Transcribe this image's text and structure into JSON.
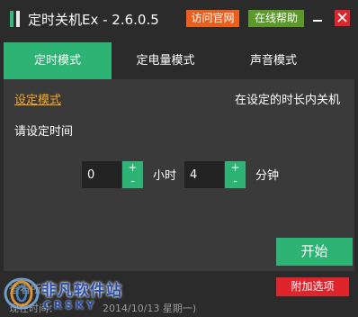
{
  "app": {
    "title": "定时关机Ex - 2.6.0.5"
  },
  "header": {
    "website_label": "访问官网",
    "help_label": "在线帮助"
  },
  "tabs": [
    {
      "label": "定时模式",
      "active": true
    },
    {
      "label": "定电量模式",
      "active": false
    },
    {
      "label": "声音模式",
      "active": false
    }
  ],
  "panel": {
    "mode_link": "设定模式",
    "mode_description": "在设定的时长内关机",
    "prompt": "请设定时间",
    "hours": {
      "value": "0",
      "unit": "小时",
      "plus": "+",
      "minus": "-"
    },
    "minutes": {
      "value": "4",
      "unit": "分钟",
      "plus": "+",
      "minus": "-"
    },
    "start_label": "开始"
  },
  "footer": {
    "reset_label": "查看所有",
    "addon_label": "附加选项",
    "status_label": "现在时间：",
    "status_date": "2014/10/13 星期一)"
  },
  "watermark": {
    "text": "非凡软件站",
    "sub": "CRSKY"
  },
  "colors": {
    "accent_green": "#2db373",
    "website_orange": "#e8601c",
    "help_green": "#5b9a2a",
    "danger_red": "#e0242c",
    "mode_link_orange": "#f5a623",
    "background": "#2b2b2b",
    "panel": "#3a3a3a"
  },
  "icons": {
    "logo": "app-logo-icon",
    "minimize": "minimize-icon",
    "close": "close-icon"
  }
}
